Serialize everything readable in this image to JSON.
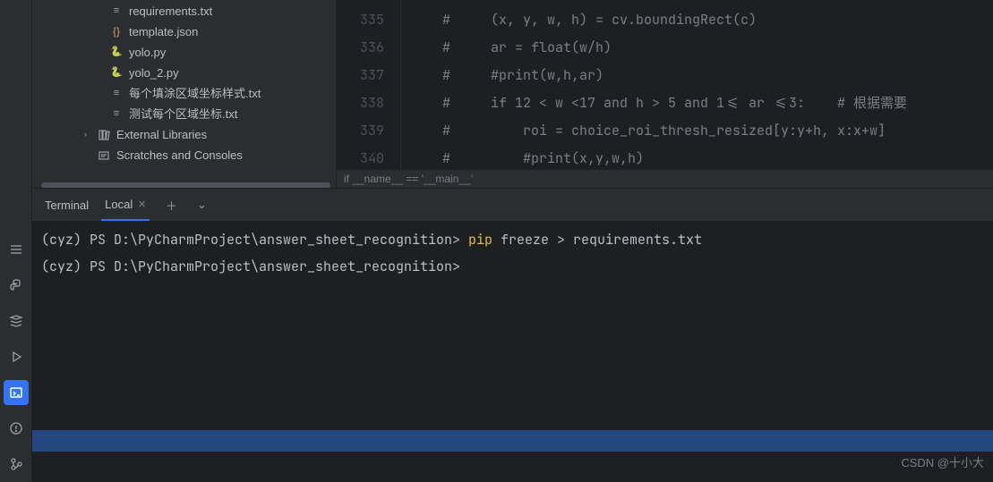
{
  "project_tree": {
    "files": [
      {
        "name": "requirements.txt",
        "type": "txt"
      },
      {
        "name": "template.json",
        "type": "json"
      },
      {
        "name": "yolo.py",
        "type": "py"
      },
      {
        "name": "yolo_2.py",
        "type": "py"
      },
      {
        "name": "每个填涂区域坐标样式.txt",
        "type": "txt"
      },
      {
        "name": "测试每个区域坐标.txt",
        "type": "txt"
      }
    ],
    "external_lib": "External Libraries",
    "scratches": "Scratches and Consoles"
  },
  "editor": {
    "line_start": 335,
    "lines": [
      "#     (x, y, w, h) = cv.boundingRect(c)",
      "#     ar = float(w/h)",
      "#     #print(w,h,ar)",
      "#     if 12 < w <17 and h > 5 and 1<= ar <=3:    # 根据需要",
      "#         roi = choice_roi_thresh_resized[y:y+h, x:x+w]",
      "#         #print(x,y,w,h)"
    ],
    "breadcrumb": "if __name__ == '__main__'"
  },
  "terminal": {
    "title": "Terminal",
    "tab": "Local",
    "lines": [
      {
        "prompt": "(cyz) PS D:\\PyCharmProject\\answer_sheet_recognition>",
        "cmd_yellow": "pip",
        "cmd_rest": " freeze > requirements.txt"
      },
      {
        "prompt": "(cyz) PS D:\\PyCharmProject\\answer_sheet_recognition>",
        "cmd_yellow": "",
        "cmd_rest": ""
      }
    ]
  },
  "watermark": "CSDN @十小大"
}
